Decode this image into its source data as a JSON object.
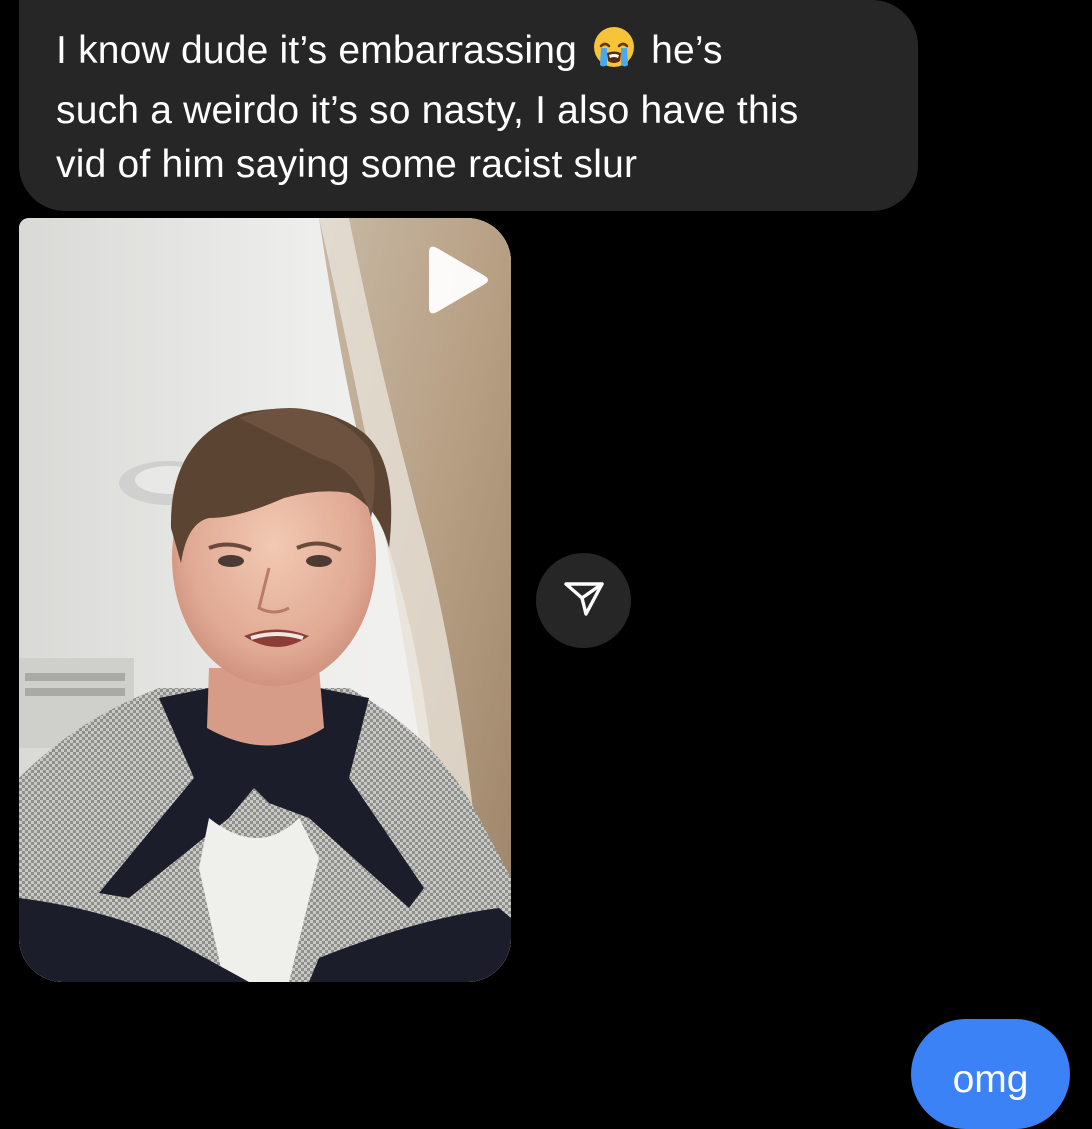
{
  "colors": {
    "background": "#000000",
    "incoming_bubble": "#262626",
    "outgoing_bubble": "#3b82f6",
    "text": "#ffffff"
  },
  "messages": [
    {
      "direction": "incoming",
      "type": "text",
      "text_before_emoji": "I know dude it’s embarrassing ",
      "emoji": "loudly-crying-face",
      "text_after_emoji": " he’s\nsuch a weirdo it’s so nasty, I also have this\nvid of him saying some racist slur"
    },
    {
      "direction": "incoming",
      "type": "video",
      "play_icon": "play-icon",
      "share_icon": "paper-plane-icon"
    },
    {
      "direction": "outgoing",
      "type": "text",
      "text": "omg"
    }
  ]
}
